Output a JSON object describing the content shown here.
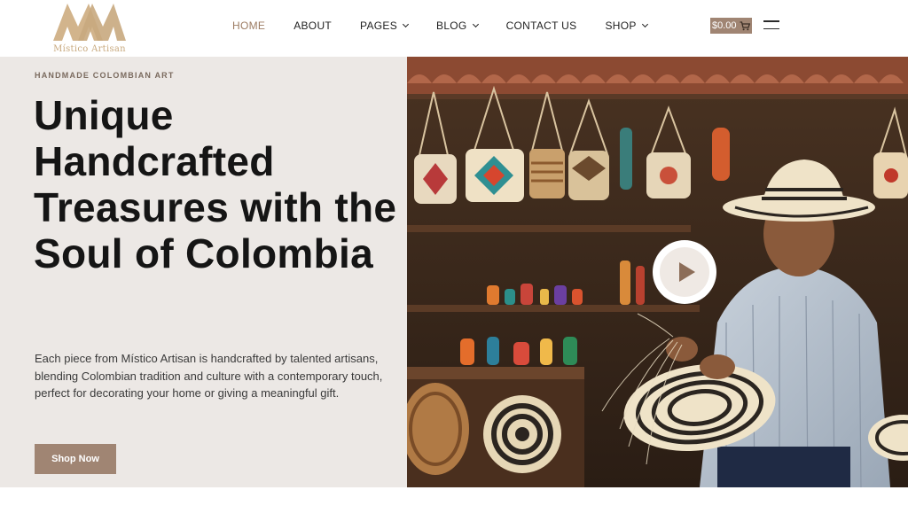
{
  "brand": {
    "name": "Místico Artisan",
    "accent": "#c8a97e"
  },
  "nav": {
    "items": [
      {
        "label": "HOME",
        "has_dropdown": false,
        "active": true
      },
      {
        "label": "ABOUT",
        "has_dropdown": false,
        "active": false
      },
      {
        "label": "PAGES",
        "has_dropdown": true,
        "active": false
      },
      {
        "label": "BLOG",
        "has_dropdown": true,
        "active": false
      },
      {
        "label": "CONTACT US",
        "has_dropdown": false,
        "active": false
      },
      {
        "label": "SHOP",
        "has_dropdown": true,
        "active": false
      }
    ]
  },
  "cart": {
    "amount": "$0.00",
    "icon": "shopping-cart-icon"
  },
  "menu_toggle": {
    "icon": "hamburger-menu-icon"
  },
  "hero": {
    "eyebrow": "HANDMADE COLOMBIAN ART",
    "headline": "Unique Handcrafted Treasures with the Soul of Colombia",
    "description": "Each piece from Místico Artisan is handcrafted by talented artisans, blending Colombian tradition and culture with a contemporary touch, perfect for decorating your home or giving a meaningful gift.",
    "cta_label": "Shop Now",
    "play_icon": "play-icon"
  },
  "colors": {
    "primary_button": "#a08573",
    "hero_background": "#ece8e5",
    "nav_active": "#9c7b62"
  }
}
